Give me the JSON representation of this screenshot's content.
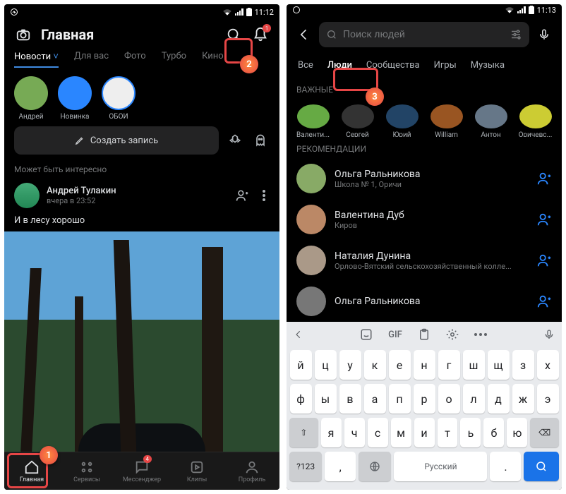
{
  "left": {
    "status": {
      "time": "11:12"
    },
    "header": {
      "title": "Главная"
    },
    "tabs": [
      "Новости",
      "Для вас",
      "Фото",
      "Турбо",
      "Кино"
    ],
    "tabs_active": 0,
    "stories": [
      {
        "label": "Андрей",
        "active": false,
        "bg": "#7a5"
      },
      {
        "label": "Новинка",
        "active": true,
        "bg": "#2a86ff"
      },
      {
        "label": "ОБОИ",
        "active": true,
        "bg": "#eee"
      }
    ],
    "compose": "Создать запись",
    "section_label": "Может быть интересно",
    "post": {
      "author": "Андрей Тулакин",
      "time": "вчера в 23:52",
      "text": "И в лесу хорошо"
    },
    "bottomnav": [
      {
        "label": "Главная",
        "icon": "home",
        "active": true
      },
      {
        "label": "Сервисы",
        "icon": "grid"
      },
      {
        "label": "Мессенджер",
        "icon": "msg",
        "badge": "4"
      },
      {
        "label": "Клипы",
        "icon": "clips"
      },
      {
        "label": "Профиль",
        "icon": "profile"
      }
    ],
    "callouts": {
      "1": "1",
      "2": "2"
    },
    "notif_badge": "1"
  },
  "right": {
    "status": {
      "time": "11:13"
    },
    "search_placeholder": "Поиск людей",
    "tabs": [
      "Все",
      "Люди",
      "Сообщества",
      "Игры",
      "Музыка"
    ],
    "tabs_active": 1,
    "important_label": "ВАЖНЫЕ",
    "important": [
      {
        "label": "Валенти...",
        "bg": "#6a4"
      },
      {
        "label": "Сергей",
        "bg": "#333"
      },
      {
        "label": "Юрий",
        "bg": "#246"
      },
      {
        "label": "William",
        "bg": "#952"
      },
      {
        "label": "Антон",
        "bg": "#678"
      },
      {
        "label": "Оричевс...",
        "bg": "#cc3"
      }
    ],
    "rec_label": "РЕКОМЕНДАЦИИ",
    "recs": [
      {
        "name": "Ольга Ральникова",
        "sub": "Школа № 1, Оричи",
        "bg": "#8a6"
      },
      {
        "name": "Валентина Дуб",
        "sub": "Киров",
        "bg": "#b86"
      },
      {
        "name": "Наталия Дунина",
        "sub": "Орлово-Вятский сельскохозяйственный колле...",
        "bg": "#a98"
      },
      {
        "name": "Ольга Ральникова",
        "sub": "",
        "bg": "#777"
      }
    ],
    "keyboard": {
      "toolbar": [
        "GIF"
      ],
      "rows": [
        [
          "й",
          "ц",
          "у",
          "к",
          "е",
          "н",
          "г",
          "ш",
          "щ",
          "з",
          "х"
        ],
        [
          "ф",
          "ы",
          "в",
          "а",
          "п",
          "р",
          "о",
          "л",
          "д",
          "ж",
          "э"
        ],
        [
          "я",
          "ч",
          "с",
          "м",
          "и",
          "т",
          "ь",
          "б",
          "ю"
        ]
      ],
      "fn": {
        "shift": "⇧",
        "del": "⌫",
        "numbers": "?123",
        "comma": ",",
        "space": "Русский",
        "dot": "."
      }
    },
    "callouts": {
      "3": "3"
    }
  }
}
